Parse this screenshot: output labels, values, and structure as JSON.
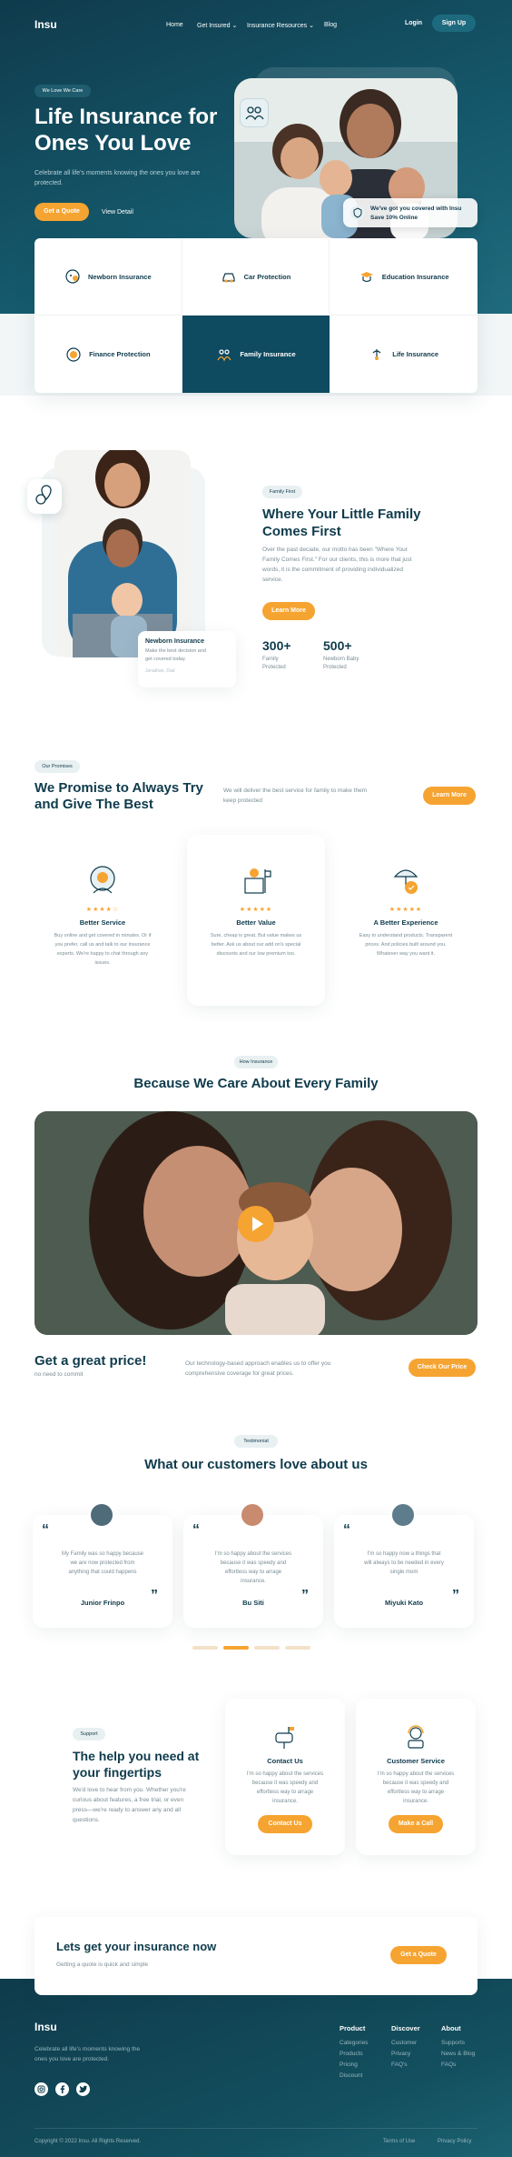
{
  "nav": {
    "logo": "Insu",
    "links": [
      "Home",
      "Get Insured",
      "Insurance Resources",
      "Blog"
    ],
    "login": "Login",
    "signup": "Sign Up"
  },
  "hero": {
    "badge": "We Love We Care",
    "title_line1": "Life Insurance for",
    "title_line2": "Ones You Love",
    "subtitle_line1": "Celebrate all life's moments knowing the ones you love are",
    "subtitle_line2": "protected.",
    "cta_primary": "Get a Quote",
    "cta_secondary": "View Detail",
    "notice_line1": "We've got you covered with Insu",
    "notice_line2": "Save 10% Online"
  },
  "categories": [
    {
      "label": "Newborn Insurance",
      "icon": "baby-icon"
    },
    {
      "label": "Car Protection",
      "icon": "car-icon"
    },
    {
      "label": "Education Insurance",
      "icon": "education-icon"
    },
    {
      "label": "Finance Protection",
      "icon": "finance-icon"
    },
    {
      "label": "Family Insurance",
      "icon": "family-icon",
      "active": true
    },
    {
      "label": "Life Insurance",
      "icon": "life-icon"
    }
  ],
  "family_first": {
    "badge": "Family First",
    "title_line1": "Where Your Little Family",
    "title_line2": "Comes First",
    "body_line1": "Over the past decade, our motto has been \"Where Your",
    "body_line2": "Family Comes First.\" For our clients, this is more that just",
    "body_line3": "words, it is the commitment of providing individualized",
    "body_line4": "service.",
    "button": "Learn More",
    "stat1_value": "300+",
    "stat1_label_line1": "Family",
    "stat1_label_line2": "Protected",
    "stat2_value": "500+",
    "stat2_label_line1": "Newborn Baby",
    "stat2_label_line2": "Protected",
    "card_title": "Newborn Insurance",
    "card_body_line1": "Make the best decision and",
    "card_body_line2": "get covered today.",
    "card_author": "Jonathan, Dad"
  },
  "promises": {
    "badge": "Our Promises",
    "title_line1": "We Promise to Always Try",
    "title_line2": "and Give The Best",
    "desc_line1": "We will deliver the best service for family to make them",
    "desc_line2": "keep protected",
    "button": "Learn More",
    "items": [
      {
        "title": "Better Service",
        "rating": 4.5,
        "l1": "Buy online and get covered in minutes. Or if",
        "l2": "you prefer, call us and talk to our insurance",
        "l3": "experts. We're happy to chat through any",
        "l4": "issues."
      },
      {
        "title": "Better Value",
        "rating": 5,
        "l1": "Sure, cheap is great. But value makes us",
        "l2": "better. Ask us about our add on's special",
        "l3": "discounts and our low premium too.",
        "l4": ""
      },
      {
        "title": "A Better Experience",
        "rating": 5,
        "l1": "Easy to understand products. Transparent",
        "l2": "prices. And policies built around you.",
        "l3": "Whatever way you want it.",
        "l4": ""
      }
    ]
  },
  "video": {
    "badge": "How Insurance",
    "title": "Because We Care About Every Family"
  },
  "price": {
    "title": "Get a great price!",
    "subtitle": "no need to commit",
    "desc_line1": "Our technology-based approach enables us to offer you",
    "desc_line2": "comprehensive coverage for great prices.",
    "button": "Check Our Price"
  },
  "testimonials": {
    "badge": "Testimonial",
    "title": "What our customers love about us",
    "items": [
      {
        "l1": "My Family was so happy because",
        "l2": "we are now protected from",
        "l3": "anything that could happens",
        "l4": "",
        "name": "Junior Frinpo"
      },
      {
        "l1": "I'm so happy about the services",
        "l2": "because it was speedy and",
        "l3": "effortless way to arrage",
        "l4": "insurance.",
        "name": "Bu Siti"
      },
      {
        "l1": "I'm so happy now a things that",
        "l2": "will always to be needed in every",
        "l3": "single mom",
        "l4": "",
        "name": "Miyuki Kato"
      }
    ]
  },
  "support": {
    "badge": "Support",
    "title_line1": "The help you need at",
    "title_line2": "your fingertips",
    "body_line1": "We'd love to hear from you. Whether you're",
    "body_line2": "curious about features, a free trial, or even",
    "body_line3": "press—we're ready to answer any and all",
    "body_line4": "questions.",
    "cards": [
      {
        "title": "Contact Us",
        "l1": "I'm so happy about the services",
        "l2": "because it was speedy and",
        "l3": "effortless way to arrage",
        "l4": "insurance.",
        "button": "Contact Us"
      },
      {
        "title": "Customer Service",
        "l1": "I'm so happy about the services",
        "l2": "because it was speedy and",
        "l3": "effortless way to arrage",
        "l4": "insurance.",
        "button": "Make a Call"
      }
    ]
  },
  "cta": {
    "title": "Lets get your insurance now",
    "subtitle": "Getting a quote is quick and simple",
    "button": "Get a Quote"
  },
  "footer": {
    "logo": "Insu",
    "tagline_line1": "Celebrate all life's moments knowing the",
    "tagline_line2": "ones you love are protected.",
    "columns": [
      {
        "heading": "Product",
        "links": [
          "Categories",
          "Products",
          "Pricing",
          "Discount"
        ]
      },
      {
        "heading": "Discover",
        "links": [
          "Customer",
          "Privacy",
          "FAQ's"
        ]
      },
      {
        "heading": "About",
        "links": [
          "Supports",
          "News & Blog",
          "FAQs"
        ]
      }
    ],
    "copyright": "Copyright © 2022 Insu. All Rights Reserved.",
    "terms": "Terms of Use",
    "privacy": "Privacy Policy"
  },
  "colors": {
    "primary": "#0f3b4c",
    "accent": "#f6a431",
    "active_card": "#0e4a60"
  }
}
